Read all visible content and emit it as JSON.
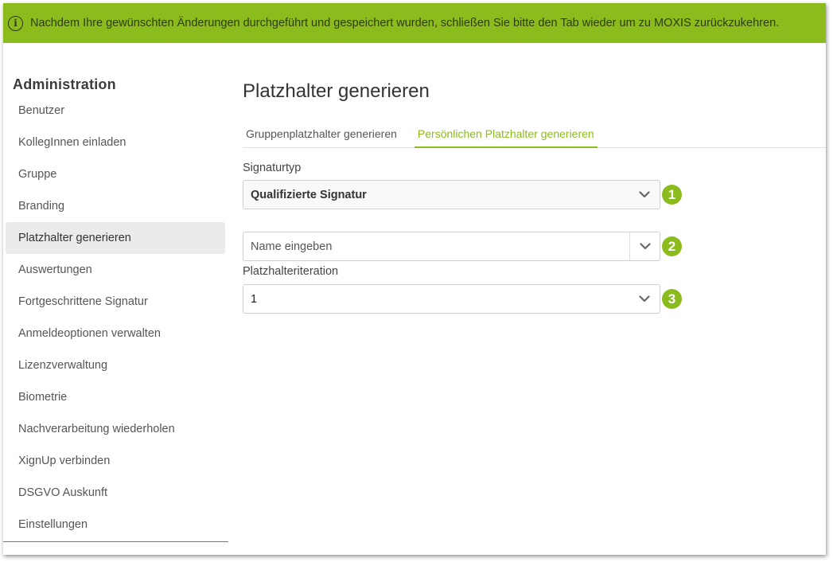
{
  "banner": {
    "icon": "info-circle-icon",
    "text": "Nachdem Ihre gewünschten Änderungen durchgeführt und gespeichert wurden, schließen Sie bitte den Tab wieder um zu MOXIS zurückzukehren."
  },
  "sidebar": {
    "title": "Administration",
    "items": [
      {
        "label": "Benutzer"
      },
      {
        "label": "KollegInnen einladen"
      },
      {
        "label": "Gruppe"
      },
      {
        "label": "Branding"
      },
      {
        "label": "Platzhalter generieren",
        "active": true
      },
      {
        "label": "Auswertungen"
      },
      {
        "label": "Fortgeschrittene Signatur"
      },
      {
        "label": "Anmeldeoptionen verwalten"
      },
      {
        "label": "Lizenzverwaltung"
      },
      {
        "label": "Biometrie"
      },
      {
        "label": "Nachverarbeitung wiederholen"
      },
      {
        "label": "XignUp verbinden"
      },
      {
        "label": "DSGVO Auskunft"
      },
      {
        "label": "Einstellungen"
      }
    ]
  },
  "main": {
    "title": "Platzhalter generieren",
    "tabs": [
      {
        "label": "Gruppenplatzhalter generieren"
      },
      {
        "label": "Persönlichen Platzhalter generieren",
        "active": true
      }
    ],
    "signature_type": {
      "label": "Signaturtyp",
      "value": "Qualifizierte Signatur",
      "callout": "1"
    },
    "name": {
      "placeholder": "Name eingeben",
      "callout": "2"
    },
    "iteration": {
      "label": "Platzhalteriteration",
      "value": "1",
      "callout": "3"
    }
  },
  "colors": {
    "accent": "#8cbb1e",
    "active_nav_bg": "#ebebeb"
  }
}
